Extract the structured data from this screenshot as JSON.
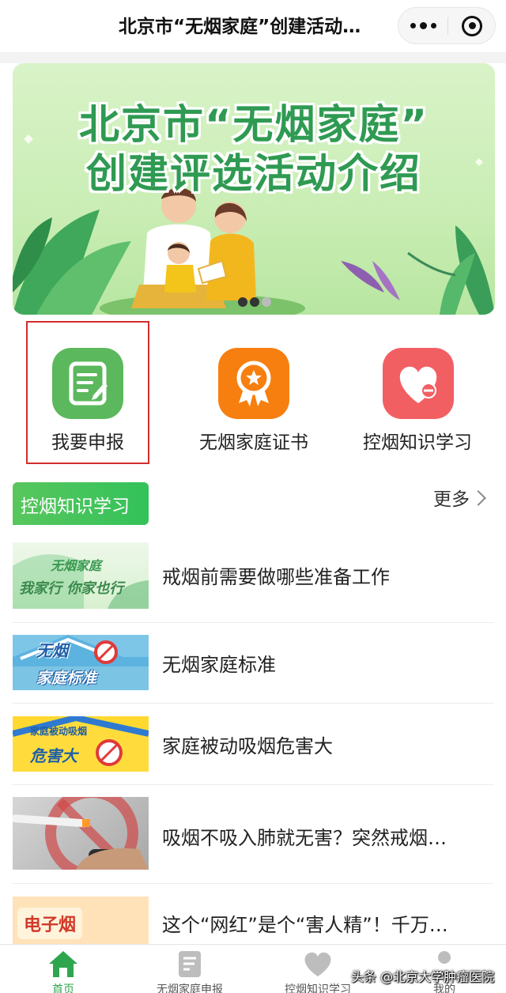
{
  "header": {
    "title": "北京市“无烟家庭”创建活动…",
    "more_icon": "more-dots-icon",
    "close_icon": "target-close-icon"
  },
  "banner": {
    "line1": "北京市“无烟家庭”",
    "line2": "创建评选活动介绍",
    "slide_count": 3,
    "active_slide": 1
  },
  "quick_entries": [
    {
      "label": "我要申报",
      "icon": "report-form-icon",
      "color": "#5cb85c"
    },
    {
      "label": "无烟家庭证书",
      "icon": "certificate-medal-icon",
      "color": "#f77f0f"
    },
    {
      "label": "控烟知识学习",
      "icon": "heart-no-smoking-icon",
      "color": "#f25f63"
    }
  ],
  "section": {
    "title": "控烟知识学习",
    "more": "更多"
  },
  "articles": [
    {
      "title": "戒烟前需要做哪些准备工作",
      "thumb_text": [
        "无烟家庭",
        "我家行 你家也行"
      ]
    },
    {
      "title": "无烟家庭标准",
      "thumb_text": [
        "无烟",
        "家庭标准"
      ]
    },
    {
      "title": "家庭被动吸烟危害大",
      "thumb_text": [
        "家庭被动吸烟",
        "危害大"
      ]
    },
    {
      "title": "吸烟不吸入肺就无害？突然戒烟…",
      "thumb_text": []
    },
    {
      "title": "这个“网红”是个“害人精”！千万…",
      "thumb_text": [
        "电子烟"
      ]
    }
  ],
  "tabbar": [
    {
      "label": "首页",
      "icon": "home-icon",
      "active": true
    },
    {
      "label": "无烟家庭申报",
      "icon": "document-icon",
      "active": false
    },
    {
      "label": "控烟知识学习",
      "icon": "heart-icon",
      "active": false
    },
    {
      "label": "我的",
      "icon": "user-icon",
      "active": false
    }
  ],
  "watermark": "头条 @北京大学肿瘤医院",
  "colors": {
    "accent_green": "#33c25a",
    "banner_green": "#2f9a52",
    "highlight_red": "#d22d2d"
  }
}
